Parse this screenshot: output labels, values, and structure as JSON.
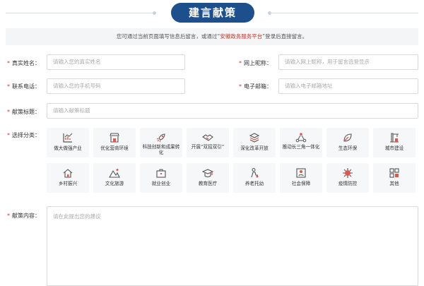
{
  "header": {
    "title": "建言献策"
  },
  "notice": {
    "before": "您可通过当前页面填写信息后留言，或通过“",
    "highlight": "安徽政务服务平台",
    "after": "”登录后直接留言。"
  },
  "form": {
    "name": {
      "label": "真实姓名：",
      "placeholder": "请输入您的真实姓名"
    },
    "nickname": {
      "label": "网上昵称：",
      "placeholder": "请输入网上昵称，用于留言选登显示"
    },
    "phone": {
      "label": "联系电话：",
      "placeholder": "请输入您的手机号码"
    },
    "email": {
      "label": "电子邮箱：",
      "placeholder": "请输入电子邮箱地址"
    },
    "title": {
      "label": "献策标题：",
      "placeholder": "请输入献策标题"
    },
    "category": {
      "label": "选择分类："
    },
    "content": {
      "label": "献策内容：",
      "placeholder": "请在此提出您的建议"
    }
  },
  "categories": [
    {
      "label": "做大做强产业",
      "icon": "chart-icon"
    },
    {
      "label": "优化营商环境",
      "icon": "shop-icon"
    },
    {
      "label": "科技创新和成果转化",
      "icon": "rocket-icon"
    },
    {
      "label": "开展“双招双引”",
      "icon": "handshake-icon"
    },
    {
      "label": "深化改革开放",
      "icon": "layers-icon"
    },
    {
      "label": "推动长三角一体化",
      "icon": "network-icon"
    },
    {
      "label": "生态环保",
      "icon": "leaf-icon"
    },
    {
      "label": "城市建设",
      "icon": "crane-icon"
    },
    {
      "label": "乡村振兴",
      "icon": "house-icon"
    },
    {
      "label": "文化旅游",
      "icon": "mountain-icon"
    },
    {
      "label": "就业创业",
      "icon": "briefcase-icon"
    },
    {
      "label": "教育医疗",
      "icon": "graduation-cap-icon"
    },
    {
      "label": "养老托幼",
      "icon": "caregiving-icon"
    },
    {
      "label": "社会保障",
      "icon": "id-card-icon"
    },
    {
      "label": "疫情防控",
      "icon": "virus-icon"
    },
    {
      "label": "其他",
      "icon": "grid-icon"
    }
  ],
  "colors": {
    "brand": "#1d4f8d",
    "icon_red": "#e0584a",
    "required": "#dd3333",
    "highlight": "#c0392b"
  }
}
